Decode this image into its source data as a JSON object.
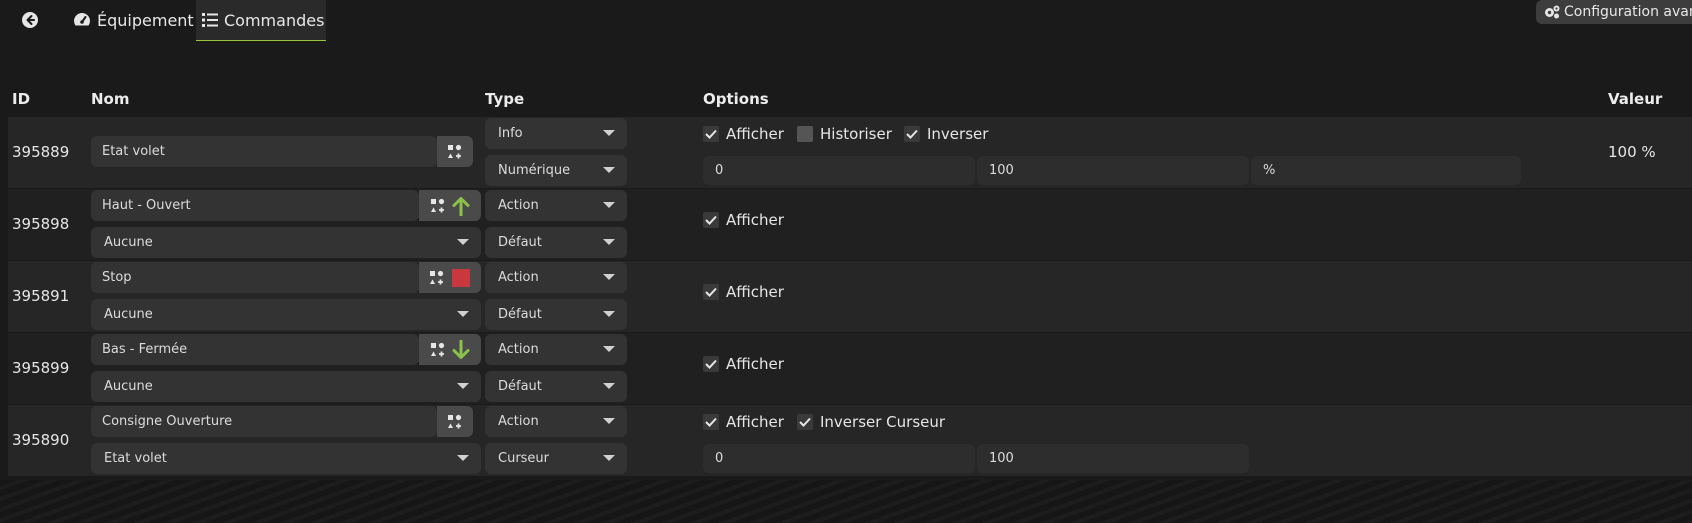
{
  "tabs": {
    "equipement": "Équipement",
    "commandes": "Commandes"
  },
  "config_button": "Configuration avancée",
  "headers": {
    "id": "ID",
    "nom": "Nom",
    "type": "Type",
    "options": "Options",
    "valeur": "Valeur"
  },
  "colors": {
    "accent": "#9ac43a",
    "arrow_green": "#8bc34a",
    "stop_red": "#c9383f"
  },
  "rows": [
    {
      "id": "395889",
      "name": "Etat volet",
      "type": "Info",
      "subtype": "Numérique",
      "options": {
        "afficher": "Afficher",
        "historiser": "Historiser",
        "inverser": "Inverser"
      },
      "min": "0",
      "max": "100",
      "unit": "%",
      "value": "100 %"
    },
    {
      "id": "395898",
      "name": "Haut - Ouvert",
      "link": "Aucune",
      "type": "Action",
      "subtype": "Défaut",
      "icon": "arrow-up-icon",
      "options": {
        "afficher": "Afficher"
      }
    },
    {
      "id": "395891",
      "name": "Stop",
      "link": "Aucune",
      "type": "Action",
      "subtype": "Défaut",
      "icon": "stop-square-icon",
      "options": {
        "afficher": "Afficher"
      }
    },
    {
      "id": "395899",
      "name": "Bas - Fermée",
      "link": "Aucune",
      "type": "Action",
      "subtype": "Défaut",
      "icon": "arrow-down-icon",
      "options": {
        "afficher": "Afficher"
      }
    },
    {
      "id": "395890",
      "name": "Consigne Ouverture",
      "link": "Etat volet",
      "type": "Action",
      "subtype": "Curseur",
      "options": {
        "afficher": "Afficher",
        "inverser_curseur": "Inverser Curseur"
      },
      "min": "0",
      "max": "100"
    }
  ]
}
